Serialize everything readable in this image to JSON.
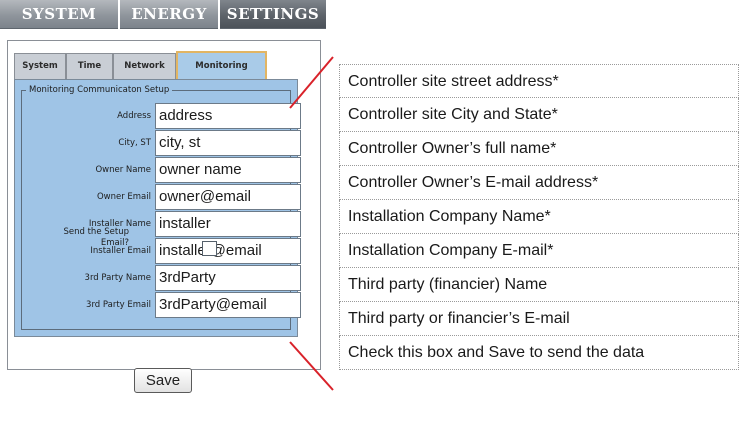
{
  "top_tabs": [
    "SYSTEM",
    "ENERGY",
    "SETTINGS"
  ],
  "active_top_tab": "SETTINGS",
  "sub_tabs": [
    "System",
    "Time",
    "Network",
    "Monitoring"
  ],
  "active_sub_tab": "Monitoring",
  "setup": {
    "title": "Monitoring Communicaton Setup",
    "fields": [
      {
        "label": "Address",
        "value": "address"
      },
      {
        "label": "City, ST",
        "value": "city, st"
      },
      {
        "label": "Owner Name",
        "value": "owner name"
      },
      {
        "label": "Owner Email",
        "value": "owner@email"
      },
      {
        "label": "Installer Name",
        "value": "installer"
      },
      {
        "label": "Installer Email",
        "value": "installer@email"
      },
      {
        "label": "3rd Party Name",
        "value": "3rdParty"
      },
      {
        "label": "3rd Party Email",
        "value": "3rdParty@email"
      }
    ],
    "send_label_line1": "Send the Setup",
    "send_label_line2": "Email?",
    "send_checked": false,
    "save_label": "Save"
  },
  "annotations": [
    "Controller site street address*",
    "Controller site City and State*",
    "Controller Owner’s full name*",
    "Controller Owner’s E-mail address*",
    "Installation Company Name*",
    "Installation Company E-mail*",
    "Third party (financier) Name",
    "Third party or financier’s E-mail",
    "Check this box and Save to send the data"
  ],
  "colors": {
    "panel_blue": "#9fc4e6",
    "active_tab_border": "#e2b563",
    "callout_line": "#d9222a"
  }
}
